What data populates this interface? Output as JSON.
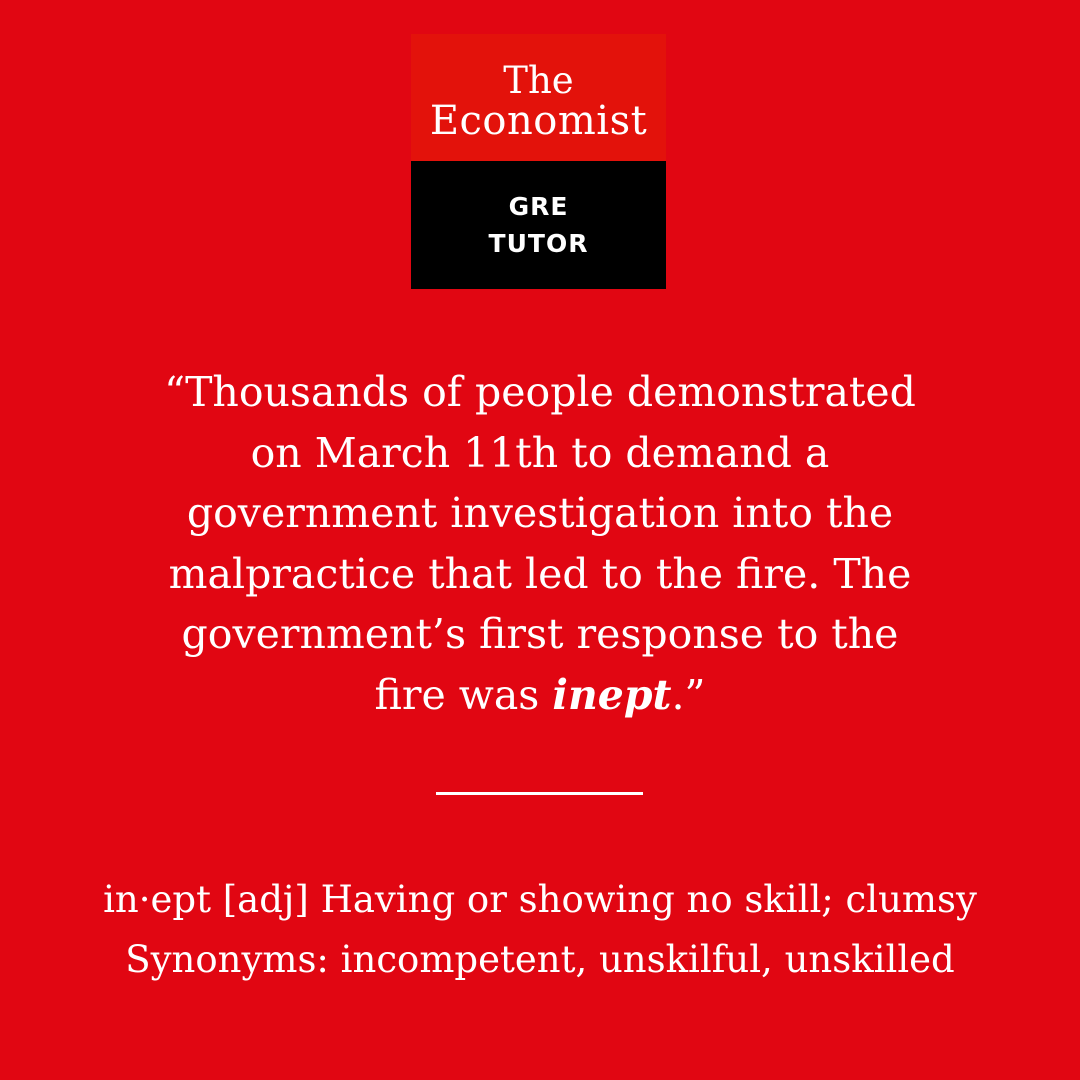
{
  "logo": {
    "the": "The",
    "name": "Economist",
    "line1": "GRE",
    "line2": "TUTOR"
  },
  "quote": {
    "line1": "“Thousands of people demonstrated",
    "line2": "on March 11th to demand a",
    "line3": "government investigation into the",
    "line4": "malpractice that led to the fire. The",
    "line5": "government’s first response to the",
    "line6_prefix": "fire was ",
    "word": "inept",
    "line6_suffix": ".”"
  },
  "definition": {
    "entry": "in·ept [adj] Having or showing no skill; clumsy",
    "synonyms": "Synonyms: incompetent, unskilful, unskilled"
  },
  "colors": {
    "background": "#e10612",
    "logo_red": "#e3120b",
    "logo_black": "#000000",
    "text": "#ffffff"
  }
}
